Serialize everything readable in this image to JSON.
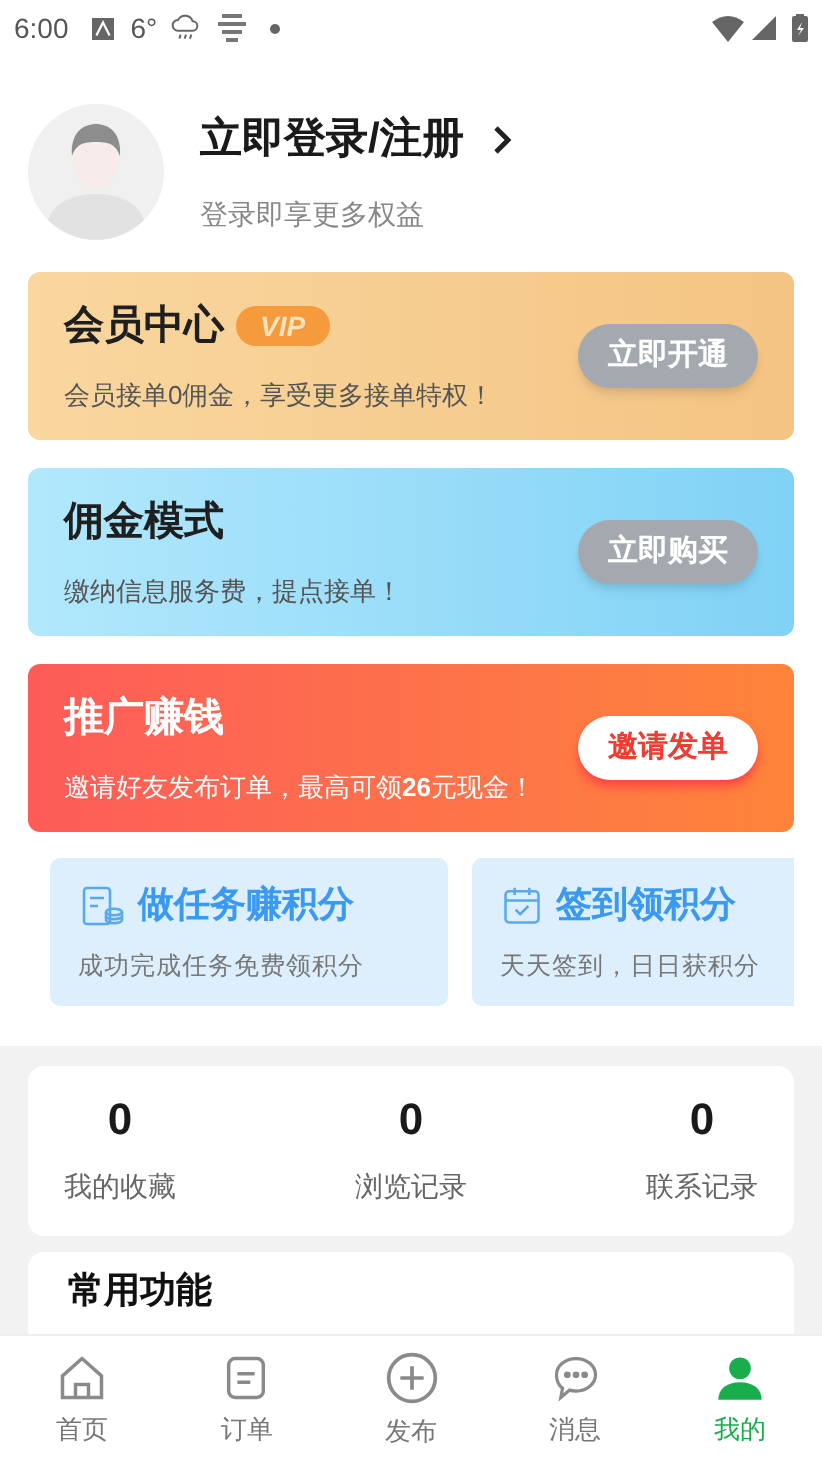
{
  "status_bar": {
    "time": "6:00",
    "temperature": "6°"
  },
  "profile": {
    "title": "立即登录/注册",
    "subtitle": "登录即享更多权益"
  },
  "promo_cards": [
    {
      "kind": "vip",
      "title": "会员中心",
      "badge": "VIP",
      "text": "会员接单0佣金，享受更多接单特权！",
      "button": "立即开通"
    },
    {
      "kind": "commission",
      "title": "佣金模式",
      "text": "缴纳信息服务费，提点接单！",
      "button": "立即购买"
    },
    {
      "kind": "promote",
      "title": "推广赚钱",
      "text": "邀请好友发布订单，最高可领**26**元现金！",
      "button": "邀请发单"
    }
  ],
  "points_cards": [
    {
      "kind": "task",
      "title": "做任务赚积分",
      "text": "成功完成任务免费领积分"
    },
    {
      "kind": "checkin",
      "title": "签到领积分",
      "text": "天天签到，日日获积分"
    }
  ],
  "stats": [
    {
      "value": "0",
      "label": "我的收藏"
    },
    {
      "value": "0",
      "label": "浏览记录"
    },
    {
      "value": "0",
      "label": "联系记录"
    }
  ],
  "functions": {
    "title": "常用功能"
  },
  "tabs": [
    {
      "kind": "home",
      "label": "首页",
      "selected": false
    },
    {
      "kind": "orders",
      "label": "订单",
      "selected": false
    },
    {
      "kind": "publish",
      "label": "发布",
      "selected": false
    },
    {
      "kind": "messages",
      "label": "消息",
      "selected": false
    },
    {
      "kind": "me",
      "label": "我的",
      "selected": true
    }
  ]
}
